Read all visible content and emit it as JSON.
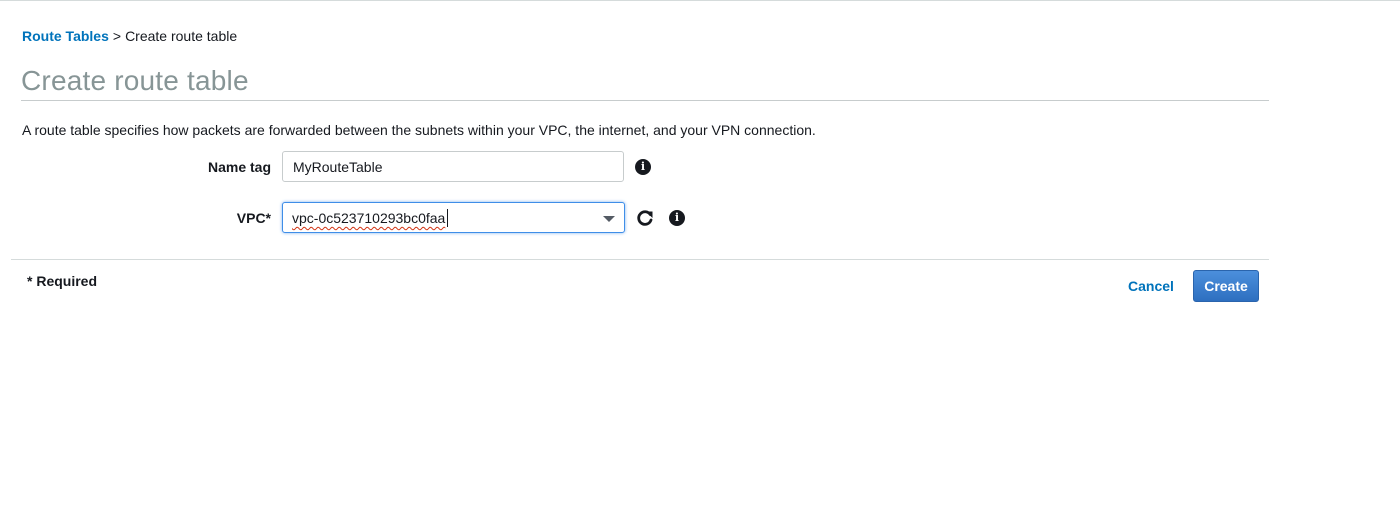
{
  "breadcrumb": {
    "parent_label": "Route Tables",
    "separator": ">",
    "current_label": "Create route table"
  },
  "page": {
    "title": "Create route table",
    "description": "A route table specifies how packets are forwarded between the subnets within your VPC, the internet, and your VPN connection."
  },
  "form": {
    "name_tag": {
      "label": "Name tag",
      "value": "MyRouteTable"
    },
    "vpc": {
      "label": "VPC*",
      "value": "vpc-0c523710293bc0faa"
    }
  },
  "footer": {
    "required_note": "* Required",
    "cancel_label": "Cancel",
    "create_label": "Create"
  },
  "icons": {
    "info": "info-icon",
    "refresh": "refresh-icon",
    "dropdown": "chevron-down-icon"
  },
  "colors": {
    "link": "#0073bb",
    "primary_button": "#2e6fc0",
    "title_gray": "#879596",
    "focus_border": "#3f8ee8"
  }
}
